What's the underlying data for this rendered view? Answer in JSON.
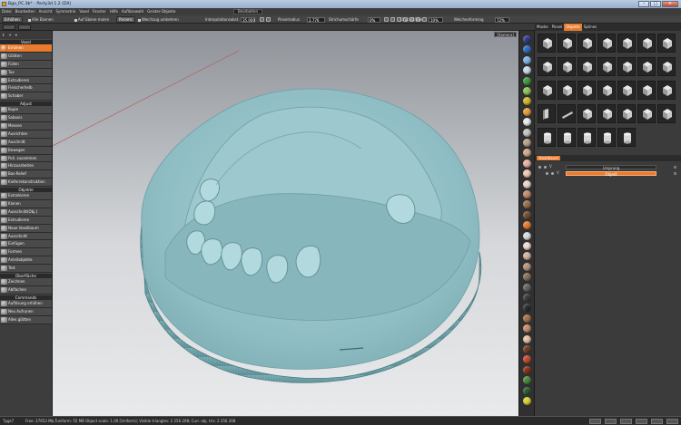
{
  "window": {
    "title": "Bgo_PC.3b* - Party3d 1.2 (DX)"
  },
  "menu": [
    "Datei",
    "Bearbeiten",
    "Ansicht",
    "Symmetrie",
    "Voxel",
    "Fenster",
    "Hilfe",
    "Auflösewahl",
    "Geister-Objekte",
    "Bearbeiten"
  ],
  "toolbar": {
    "erhoehen": "Erhöhen",
    "alle_ebenen": "Alle Ebenen",
    "auf_ebene": "Auf Ebene malen",
    "params": "Params",
    "weichzug": "Weichzug umkehren",
    "interpolation_label": "Interpolationsabst.",
    "interpolation_value": "35.000",
    "pinselradius_label": "Pinselradius",
    "pinselradius_value": "2.776",
    "stichrahmen_label": "Strichumschärfe",
    "stichrahmen_value": "0%",
    "druckstaerke_label": "Druckstärke",
    "druckstaerke_value": "10%",
    "weichrahmen_label": "Weichenforming",
    "weichrahmen_value": "72%"
  },
  "viewport": {
    "camera": "[Kamera]"
  },
  "left_panel": {
    "sections": [
      {
        "title": "Voxel",
        "items": [
          "Erhöhen",
          "Glätten",
          "Füllen",
          "Tux",
          "Extrudieren",
          "Fleischerhelb",
          "Schaber"
        ]
      },
      {
        "title": "Adjust",
        "items": [
          "Kopie",
          "Saboxis",
          "Messen",
          "Ausrichten",
          "Auschnitt",
          "Bewegen",
          "Poli. zusammen",
          "Hinzuarbeiten",
          "Bas-Relief",
          "Kieferrekonstruktion"
        ]
      },
      {
        "title": "Objekte",
        "items": [
          "Extrahieren",
          "Klonen",
          "Ausschnitt(Obj.)",
          "Extrudieren",
          "Neue Voxelbaum",
          "Ausschnitt",
          "Einfügen",
          "Formen",
          "Anleitobjekte",
          "Test"
        ]
      },
      {
        "title": "Oberfläche",
        "items": [
          "Zeichnen",
          "Abflachen"
        ]
      },
      {
        "title": "Commands",
        "items": [
          "Auflösung erhöhen",
          "Neu Aufrunen",
          "Alles glätten"
        ]
      }
    ]
  },
  "right_panel": {
    "tabs": [
      "Maske",
      "Pinsel",
      "Objekte",
      "Splines"
    ],
    "active_tab": "Objekte",
    "layer_header": "Voxelbaum",
    "layers": [
      {
        "label": "Ursprung"
      },
      {
        "label": "Objekt"
      }
    ]
  },
  "swatches": [
    "#2e3a8a",
    "#2d6cc0",
    "#7fb4e6",
    "#c9dcea",
    "#3f9a3e",
    "#8ac456",
    "#d6b82a",
    "#e89e3a",
    "#eaecee",
    "#c9c6c0",
    "#b8a28a",
    "#d2a88c",
    "#e9b3a0",
    "#f2c8b8",
    "#f0d6c8",
    "#c48b6a",
    "#9a6f4e",
    "#6f4f36",
    "#e97b2f",
    "#d9dcdf",
    "#f1dcd6",
    "#d6b29d",
    "#b5937c",
    "#8a6e58",
    "#646464",
    "#3a3a3a",
    "#2b2b2b",
    "#a87048",
    "#c68e68",
    "#e6c4a8",
    "#6e3c24",
    "#c84a2a",
    "#8a2f1a",
    "#4a8a3a",
    "#2a5a2a",
    "#d8d430"
  ],
  "status": {
    "left": "Tpgs7",
    "main": "Free: 27653 Mb,Tuniform: 55 MB Object scale: 1.00 [Uniform]; Visible triangles: 2 256 208; Curr. obj. tris: 2 256 208"
  }
}
